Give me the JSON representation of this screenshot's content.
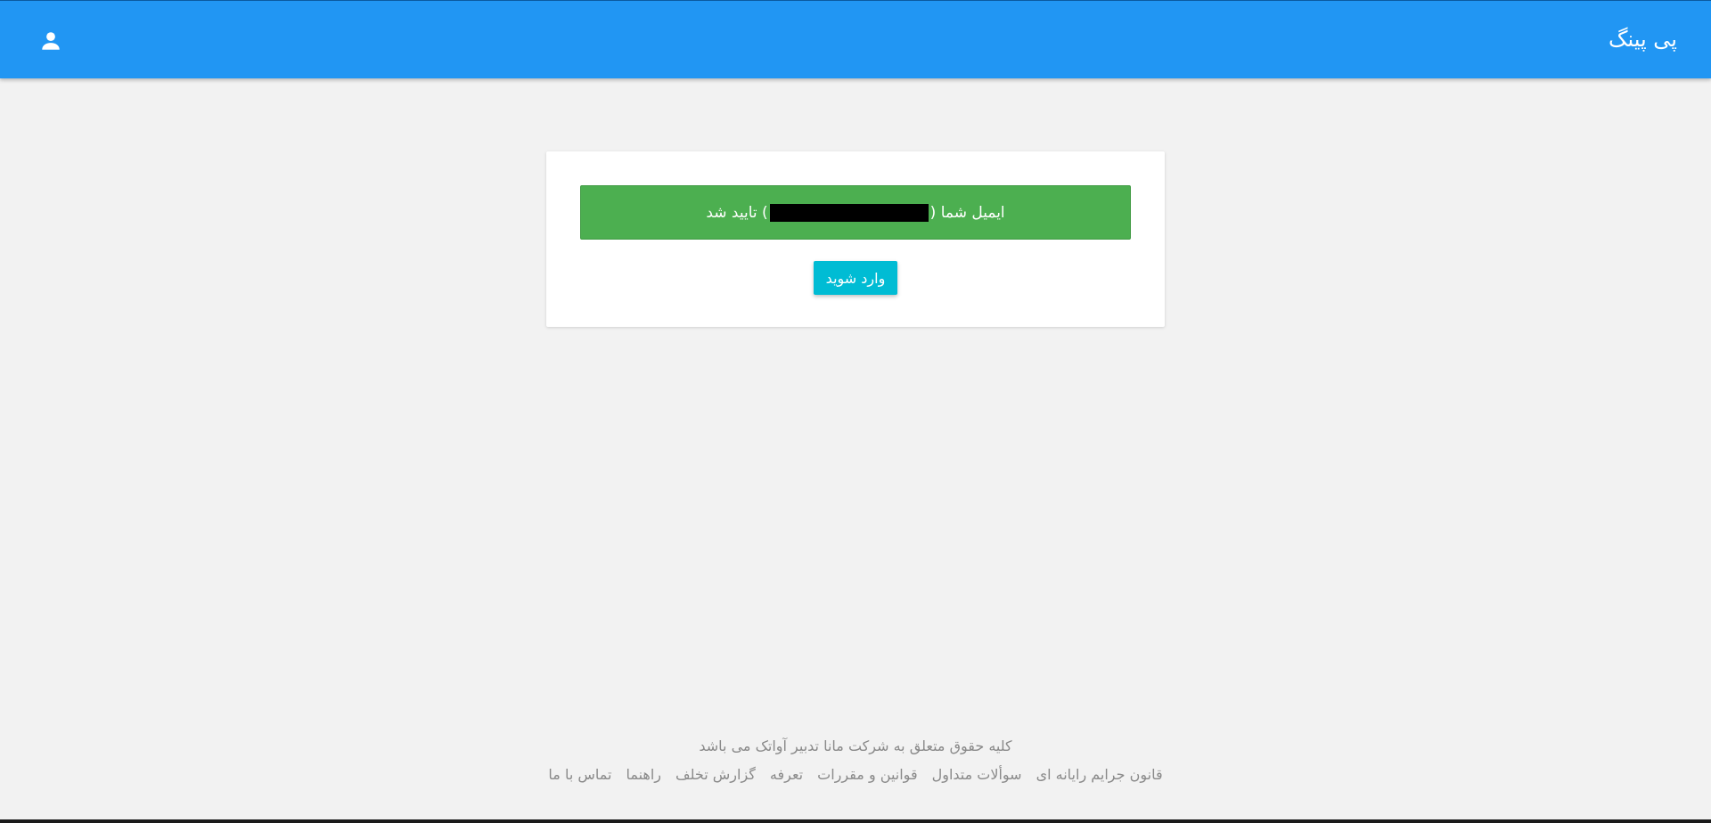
{
  "header": {
    "brand": "پی پینگ",
    "user_icon": "account-icon",
    "colors": {
      "bar": "#2196f3"
    }
  },
  "confirmation": {
    "message_prefix": "ایمیل شما (",
    "message_suffix": ") تایید شد",
    "alert_color": "#4caf50"
  },
  "login_button": {
    "label": "وارد شوید",
    "color": "#00bcd4"
  },
  "footer": {
    "copyright": "کلیه حقوق متعلق به شرکت مانا تدبیر آواتک می باشد",
    "links": [
      "قانون جرایم رایانه ای",
      "سوألات متداول",
      "قوانین و مقررات",
      "تعرفه",
      "گزارش تخلف",
      "راهنما",
      "تماس با ما"
    ]
  }
}
